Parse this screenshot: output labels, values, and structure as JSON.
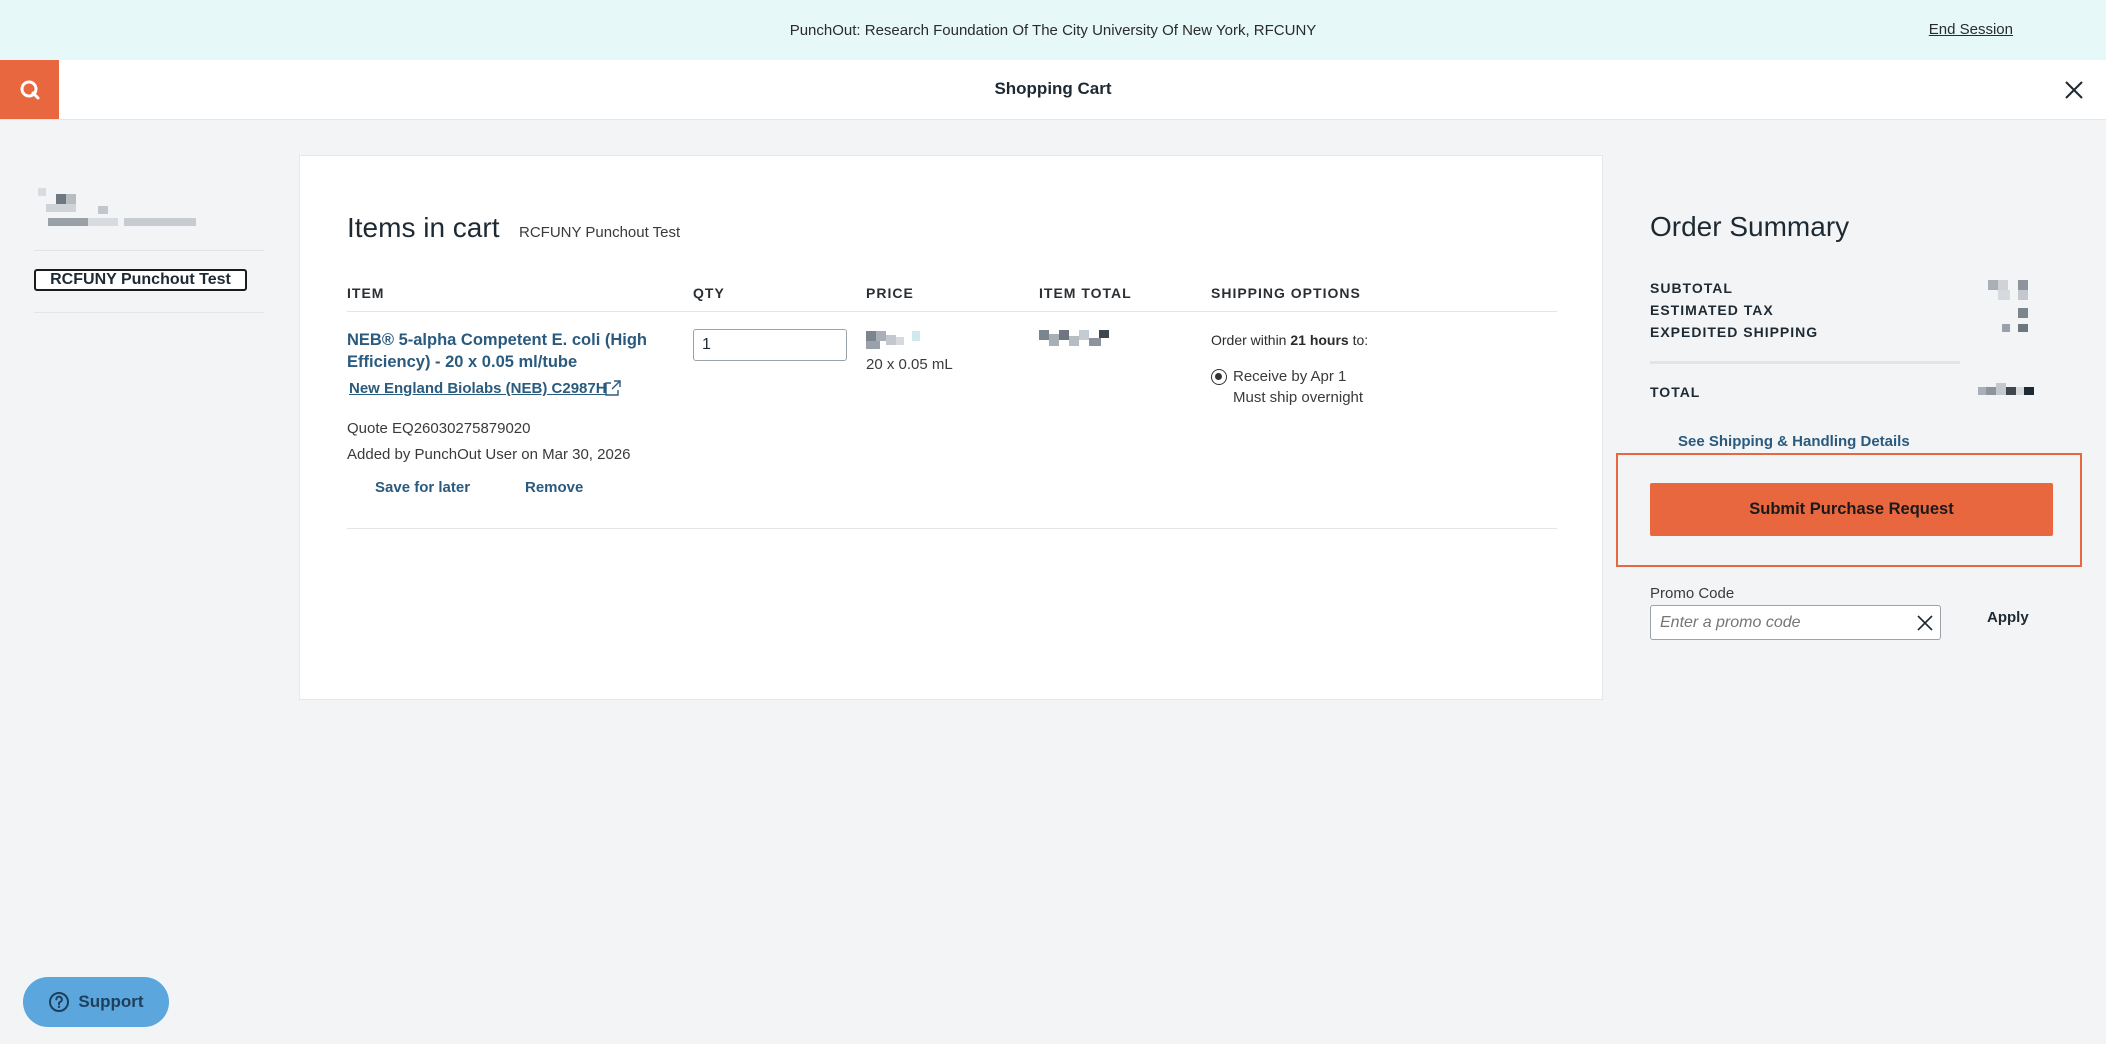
{
  "banner": {
    "text": "PunchOut: Research Foundation Of The City University Of New York, RFCUNY",
    "end_session": "End Session"
  },
  "header": {
    "title": "Shopping Cart"
  },
  "sidebar": {
    "active_item": "RCFUNY Punchout Test"
  },
  "cart": {
    "title": "Items in cart",
    "subtitle": "RCFUNY Punchout Test",
    "columns": [
      "ITEM",
      "QTY",
      "PRICE",
      "ITEM TOTAL",
      "SHIPPING OPTIONS"
    ],
    "item": {
      "name": "NEB® 5-alpha Competent E. coli (High Efficiency) - 20 x 0.05 ml/tube",
      "brand_link": "New England Biolabs (NEB) C2987H",
      "quote": "Quote EQ26030275879020",
      "added_by": "Added by PunchOut User on Mar 30, 2026",
      "save_for_later": "Save for later",
      "remove": "Remove",
      "qty": "1",
      "pack_size": "20 x 0.05 mL",
      "ship_prefix": "Order within",
      "ship_hours": "21 hours",
      "ship_suffix": "to:",
      "receive_by": "Receive by Apr 1",
      "ship_note": "Must ship overnight"
    }
  },
  "summary": {
    "title": "Order Summary",
    "subtotal_label": "SUBTOTAL",
    "tax_label": "ESTIMATED TAX",
    "shipping_label": "EXPEDITED SHIPPING",
    "total_label": "TOTAL",
    "shipping_details_link": "See Shipping & Handling Details",
    "submit_label": "Submit Purchase Request",
    "promo_label": "Promo Code",
    "promo_placeholder": "Enter a promo code",
    "apply_label": "Apply"
  },
  "support": {
    "label": "Support"
  },
  "colors": {
    "accent": "#e8673f",
    "link": "#2a5b7e",
    "banner_bg": "#e6f8f8",
    "support_bg": "#5aa6dd"
  },
  "icons": [
    "brand-logo-icon",
    "close-icon",
    "external-link-icon",
    "clear-icon",
    "help-icon"
  ]
}
